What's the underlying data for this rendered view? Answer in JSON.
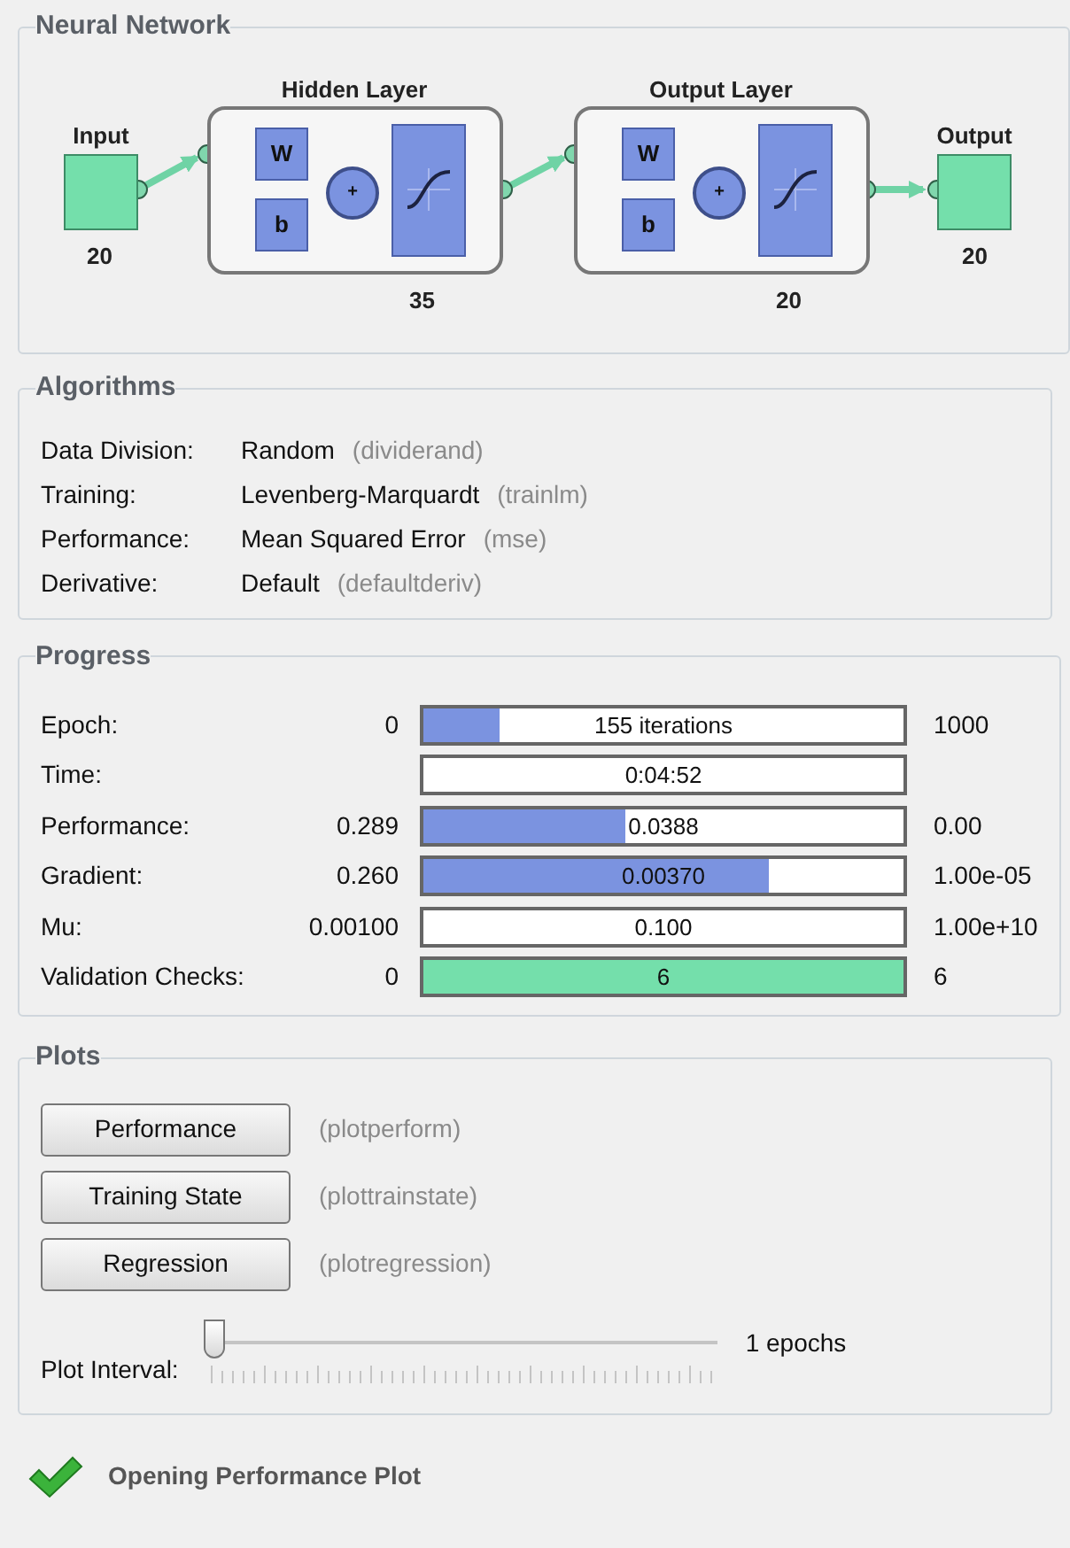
{
  "network": {
    "title": "Neural Network",
    "input": {
      "label": "Input",
      "size": "20"
    },
    "layers": [
      {
        "title": "Hidden Layer",
        "weight": "W",
        "bias": "b",
        "sum": "+",
        "size": "35"
      },
      {
        "title": "Output Layer",
        "weight": "W",
        "bias": "b",
        "sum": "+",
        "size": "20"
      }
    ],
    "output": {
      "label": "Output",
      "size": "20"
    }
  },
  "algorithms": {
    "title": "Algorithms",
    "rows": [
      {
        "label": "Data Division:",
        "value": "Random",
        "function": "(dividerand)"
      },
      {
        "label": "Training:",
        "value": "Levenberg-Marquardt",
        "function": "(trainlm)"
      },
      {
        "label": "Performance:",
        "value": "Mean Squared Error",
        "function": "(mse)"
      },
      {
        "label": "Derivative:",
        "value": "Default",
        "function": "(defaultderiv)"
      }
    ]
  },
  "progress": {
    "title": "Progress",
    "rows": [
      {
        "kind": "meter",
        "label": "Epoch:",
        "start": "0",
        "value": "155 iterations",
        "end": "1000",
        "level": 0.16
      },
      {
        "kind": "plain",
        "label": "Time:",
        "value": "0:04:52"
      },
      {
        "kind": "meter",
        "label": "Performance:",
        "start": "0.289",
        "value": "0.0388",
        "end": "0.00",
        "level": 0.42
      },
      {
        "kind": "meter",
        "label": "Gradient:",
        "start": "0.260",
        "value": "0.00370",
        "end": "1.00e-05",
        "level": 0.72
      },
      {
        "kind": "meter",
        "label": "Mu:",
        "start": "0.00100",
        "value": "0.100",
        "end": "1.00e+10"
      },
      {
        "kind": "checks",
        "label": "Validation Checks:",
        "start": "0",
        "value": "6",
        "end": "6",
        "level": 1
      }
    ]
  },
  "plots": {
    "title": "Plots",
    "buttons": [
      {
        "label": "Performance",
        "function": "(plotperform)"
      },
      {
        "label": "Training State",
        "function": "(plottrainstate)"
      },
      {
        "label": "Regression",
        "function": "(plotregression)"
      }
    ],
    "interval": {
      "label": "Plot Interval:",
      "level": 0,
      "reading": "1 epochs"
    }
  },
  "status": {
    "text": "Opening Performance Plot"
  }
}
